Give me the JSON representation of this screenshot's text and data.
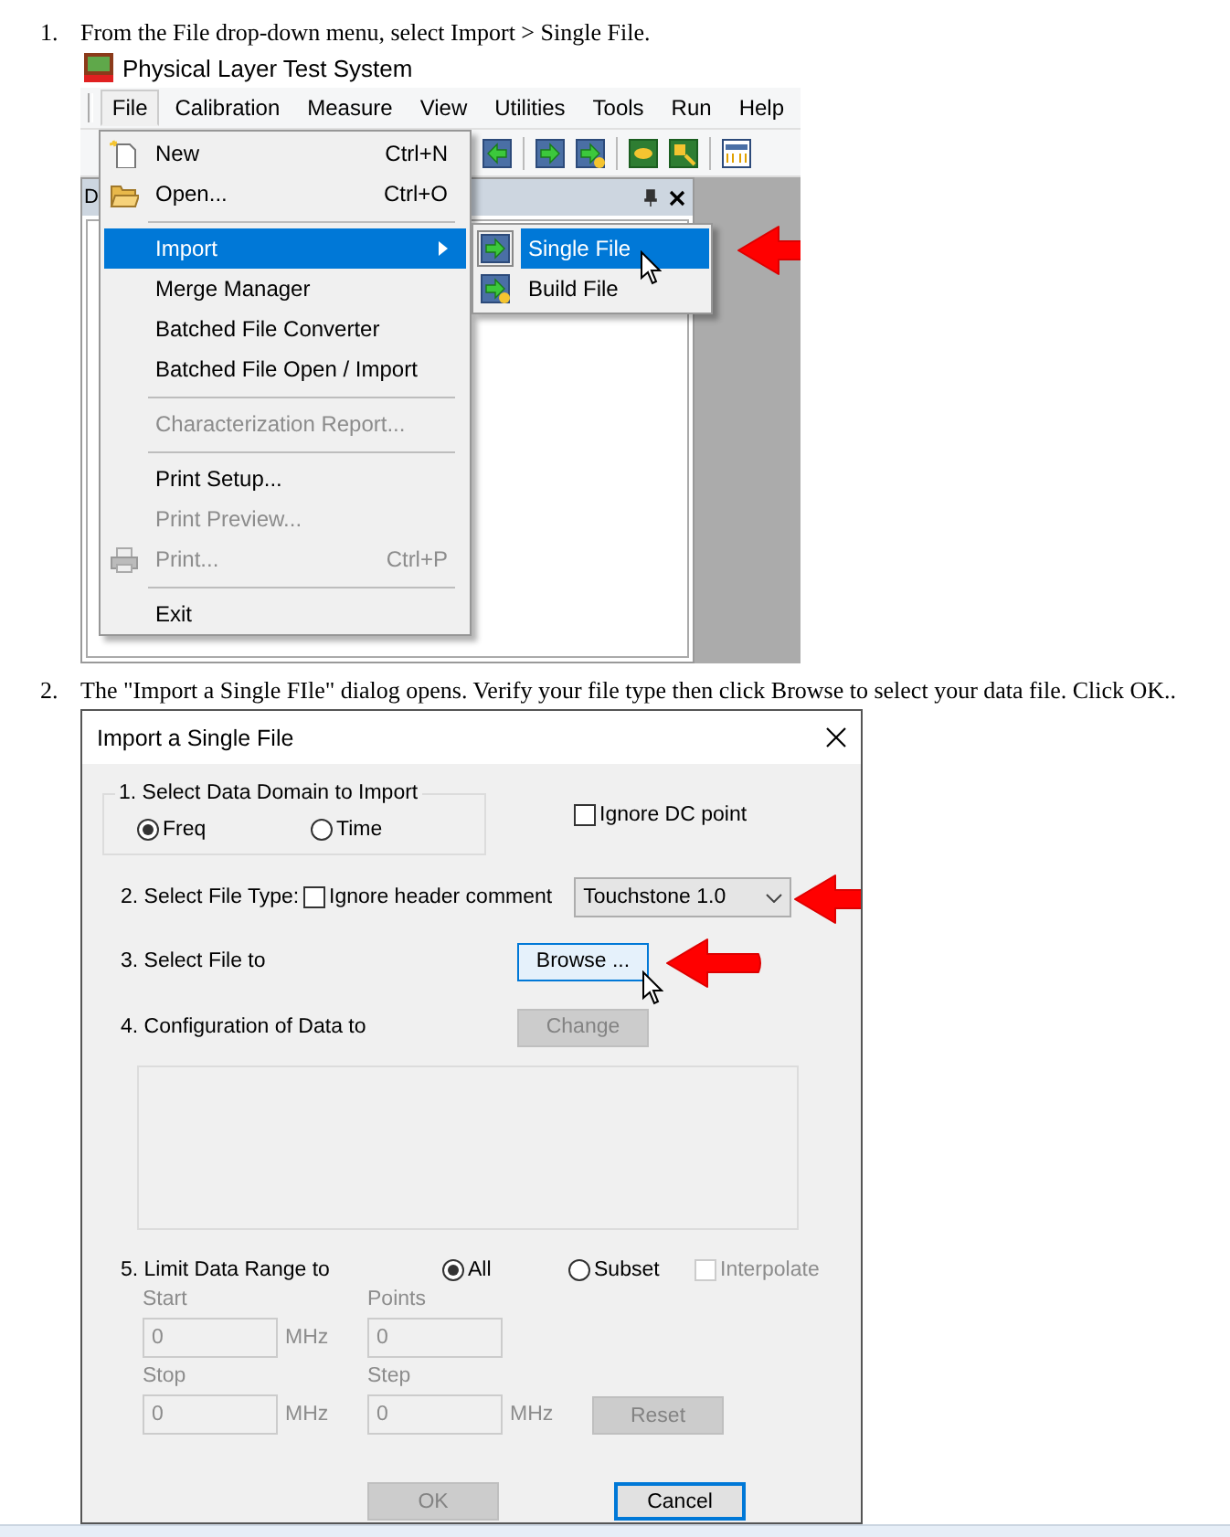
{
  "steps": [
    {
      "number": "1.",
      "text": "From the File drop-down menu, select Import > Single File."
    },
    {
      "number": "2.",
      "text": "The \"Import a Single FIle\" dialog opens. Verify your file type then click Browse to select your data file. Click OK.."
    }
  ],
  "app": {
    "title": "Physical Layer Test System",
    "menubar": [
      {
        "label": "File",
        "selected": true
      },
      {
        "label": "Calibration",
        "selected": false
      },
      {
        "label": "Measure",
        "selected": false
      },
      {
        "label": "View",
        "selected": false
      },
      {
        "label": "Utilities",
        "selected": false
      },
      {
        "label": "Tools",
        "selected": false
      },
      {
        "label": "Run",
        "selected": false
      },
      {
        "label": "Help",
        "selected": false
      }
    ],
    "panel_title": "D",
    "file_menu": [
      {
        "kind": "item",
        "label": "New",
        "shortcut": "Ctrl+N",
        "disabled": false,
        "selected": false
      },
      {
        "kind": "item",
        "label": "Open...",
        "shortcut": "Ctrl+O",
        "disabled": false,
        "selected": false
      },
      {
        "kind": "separator"
      },
      {
        "kind": "item",
        "label": "Import",
        "disabled": false,
        "selected": true,
        "submenu": true
      },
      {
        "kind": "item",
        "label": "Merge Manager",
        "disabled": false,
        "selected": false
      },
      {
        "kind": "item",
        "label": "Batched File Converter",
        "disabled": false,
        "selected": false
      },
      {
        "kind": "item",
        "label": "Batched File Open / Import",
        "disabled": false,
        "selected": false
      },
      {
        "kind": "separator"
      },
      {
        "kind": "item",
        "label": "Characterization Report...",
        "disabled": true,
        "selected": false
      },
      {
        "kind": "separator"
      },
      {
        "kind": "item",
        "label": "Print Setup...",
        "disabled": false,
        "selected": false
      },
      {
        "kind": "item",
        "label": "Print Preview...",
        "disabled": true,
        "selected": false
      },
      {
        "kind": "item",
        "label": "Print...",
        "shortcut": "Ctrl+P",
        "disabled": true,
        "selected": false
      },
      {
        "kind": "separator"
      },
      {
        "kind": "item",
        "label": "Exit",
        "disabled": false,
        "selected": false
      }
    ],
    "submenu": [
      {
        "label": "Single File",
        "selected": true
      },
      {
        "label": "Build File",
        "selected": false
      }
    ]
  },
  "dialog": {
    "title": "Import a Single File",
    "domain": {
      "legend": "1. Select Data Domain to Import",
      "options": [
        {
          "label": "Freq",
          "selected": true
        },
        {
          "label": "Time",
          "selected": false
        }
      ]
    },
    "ignore_dc": {
      "label": "Ignore DC point",
      "checked": false
    },
    "file_type": {
      "label": "2. Select File Type:",
      "ignore_header": {
        "label": "Ignore header comment",
        "checked": false
      },
      "value": "Touchstone 1.0"
    },
    "select_file": {
      "label": "3. Select File to",
      "button": "Browse ..."
    },
    "config": {
      "label": "4. Configuration of Data to",
      "button": "Change",
      "disabled": true
    },
    "range": {
      "label": "5. Limit Data Range to",
      "options": [
        {
          "label": "All",
          "selected": true
        },
        {
          "label": "Subset",
          "selected": false
        }
      ],
      "interpolate": {
        "label": "Interpolate",
        "checked": false,
        "disabled": true
      },
      "fields": [
        {
          "label": "Start",
          "value": "0",
          "unit": "MHz",
          "disabled": true
        },
        {
          "label": "Points",
          "value": "0",
          "disabled": true
        },
        {
          "label": "Stop",
          "value": "0",
          "unit": "MHz",
          "disabled": true
        },
        {
          "label": "Step",
          "value": "0",
          "unit": "MHz",
          "disabled": true
        }
      ],
      "reset": {
        "label": "Reset",
        "disabled": true
      }
    },
    "buttons": [
      {
        "label": "OK",
        "disabled": true,
        "default": false
      },
      {
        "label": "Cancel",
        "disabled": false,
        "default": true
      }
    ]
  }
}
